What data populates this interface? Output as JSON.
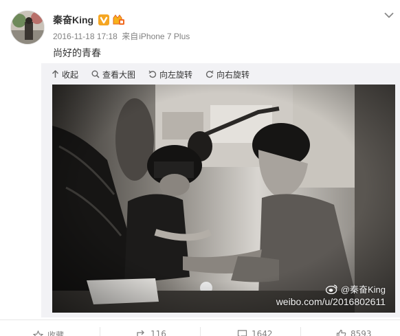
{
  "post": {
    "username": "秦奋King",
    "timestamp": "2016-11-18 17:18",
    "source_prefix": "来自",
    "device": "iPhone 7 Plus",
    "text": "尚好的青春",
    "badges": [
      "verified-v-icon",
      "vip-crown-icon"
    ]
  },
  "media_toolbar": {
    "collapse_label": "收起",
    "view_large_label": "查看大图",
    "rotate_left_label": "向左旋转",
    "rotate_right_label": "向右旋转"
  },
  "watermark": {
    "handle": "@秦奋King",
    "url": "weibo.com/u/2016802611"
  },
  "actions": {
    "favorite_label": "收藏",
    "repost_count": "116",
    "comment_count": "1642",
    "like_count": "8593"
  },
  "colors": {
    "badge_orange": "#f5a623",
    "meta_gray": "#808080",
    "media_bg": "#f2f2f5"
  }
}
